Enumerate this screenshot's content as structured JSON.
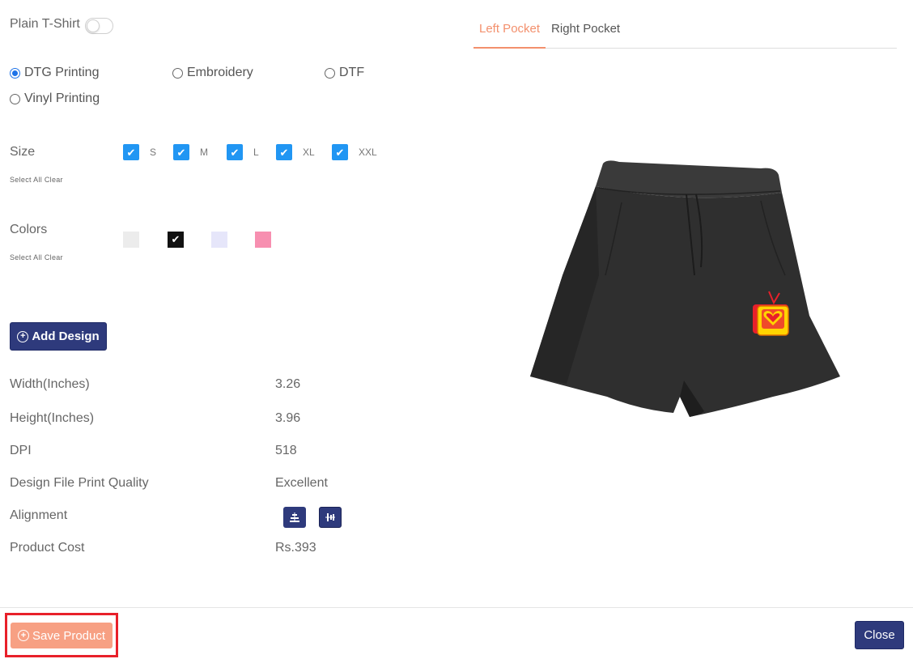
{
  "toggle": {
    "label": "Plain T-Shirt"
  },
  "print_methods": [
    {
      "label": "DTG Printing",
      "selected": true
    },
    {
      "label": "Embroidery",
      "selected": false
    },
    {
      "label": "DTF",
      "selected": false
    },
    {
      "label": "Vinyl Printing",
      "selected": false
    }
  ],
  "size": {
    "label": "Size",
    "select_all": "Select All",
    "clear": "Clear",
    "options": [
      {
        "name": "S",
        "checked": true
      },
      {
        "name": "M",
        "checked": true
      },
      {
        "name": "L",
        "checked": true
      },
      {
        "name": "XL",
        "checked": true
      },
      {
        "name": "XXL",
        "checked": true
      }
    ]
  },
  "colors": {
    "label": "Colors",
    "select_all": "Select All",
    "clear": "Clear",
    "swatches": [
      {
        "hex": "#ececec",
        "checked": false
      },
      {
        "hex": "#111111",
        "checked": true
      },
      {
        "hex": "#e6e6fa",
        "checked": false
      },
      {
        "hex": "#f78fb0",
        "checked": false
      }
    ]
  },
  "add_design_label": "Add Design",
  "info": {
    "width_label": "Width(Inches)",
    "width_value": "3.26",
    "height_label": "Height(Inches)",
    "height_value": "3.96",
    "dpi_label": "DPI",
    "dpi_value": "518",
    "quality_label": "Design File Print Quality",
    "quality_value": "Excellent",
    "alignment_label": "Alignment",
    "cost_label": "Product Cost",
    "cost_value": "Rs.393"
  },
  "tabs": [
    {
      "label": "Left Pocket",
      "active": true
    },
    {
      "label": "Right Pocket",
      "active": false
    }
  ],
  "footer": {
    "save_label": "Save Product",
    "close_label": "Close"
  },
  "colors_theme": {
    "primary": "#2e3a7c",
    "accent": "#f3906d",
    "check": "#2196f3"
  }
}
